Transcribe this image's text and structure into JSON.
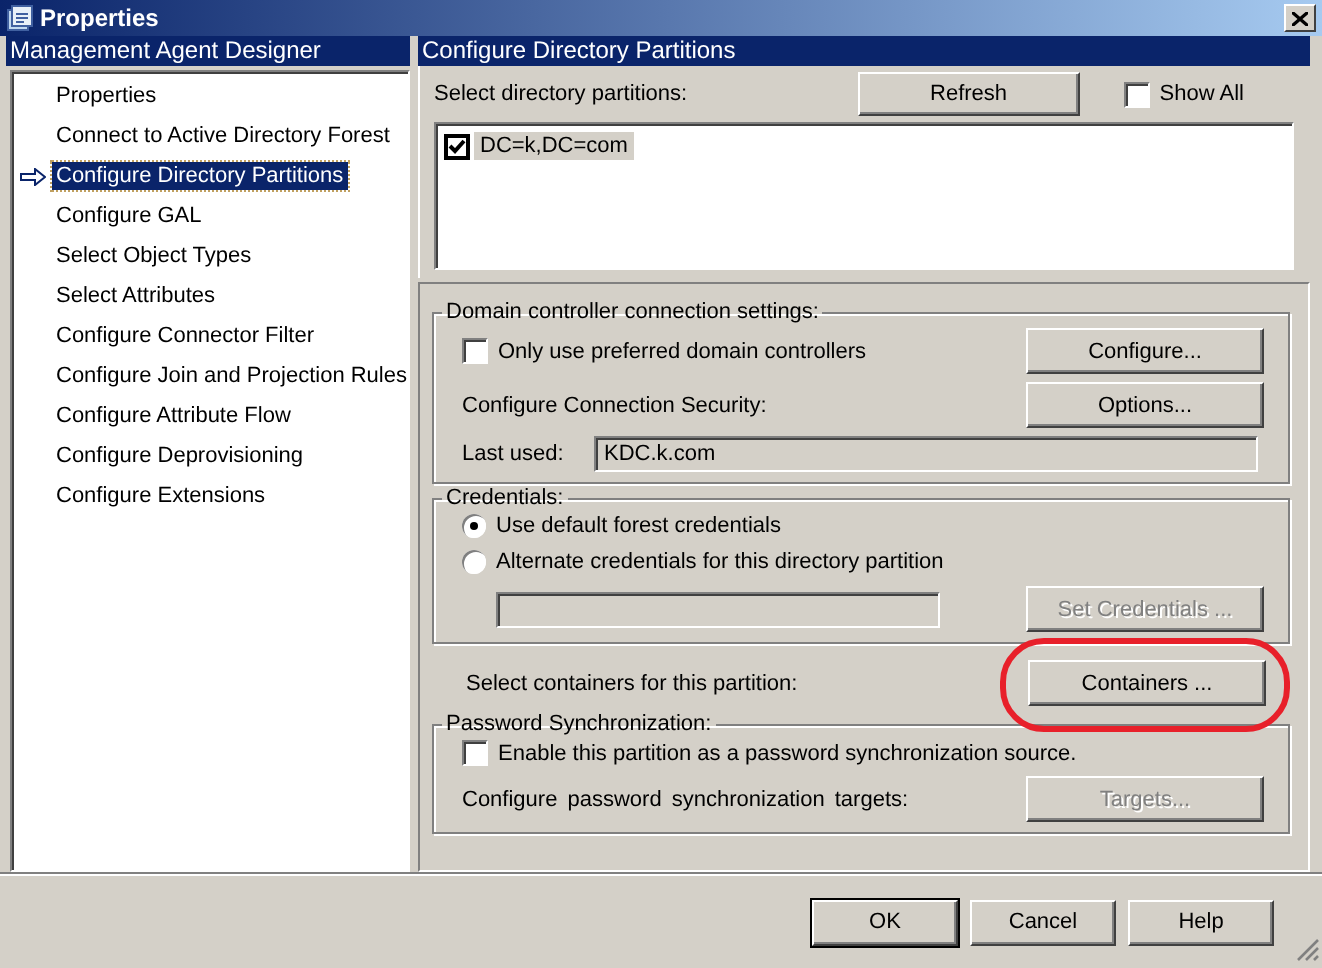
{
  "window": {
    "title": "Properties"
  },
  "sidebar": {
    "header": "Management Agent Designer",
    "items": [
      {
        "label": "Properties",
        "selected": false
      },
      {
        "label": "Connect to Active Directory Forest",
        "selected": false
      },
      {
        "label": "Configure Directory Partitions",
        "selected": true
      },
      {
        "label": "Configure GAL",
        "selected": false
      },
      {
        "label": "Select Object Types",
        "selected": false
      },
      {
        "label": "Select Attributes",
        "selected": false
      },
      {
        "label": "Configure Connector Filter",
        "selected": false
      },
      {
        "label": "Configure Join and Projection Rules",
        "selected": false
      },
      {
        "label": "Configure Attribute Flow",
        "selected": false
      },
      {
        "label": "Configure Deprovisioning",
        "selected": false
      },
      {
        "label": "Configure Extensions",
        "selected": false
      }
    ]
  },
  "pane": {
    "header": "Configure Directory Partitions",
    "partitions": {
      "label": "Select directory partitions:",
      "refresh_button": {
        "label": "Refresh",
        "disabled": false
      },
      "show_all": {
        "label": "Show All",
        "checked": false
      },
      "items": [
        {
          "label": "DC=k,DC=com",
          "checked": true
        }
      ]
    },
    "dc_settings": {
      "title": "Domain controller connection settings:",
      "preferred": {
        "label": "Only use preferred domain controllers",
        "checked": false
      },
      "configure_button": {
        "label": "Configure...",
        "disabled": false
      },
      "security_label": "Configure Connection Security:",
      "options_button": {
        "label": "Options...",
        "disabled": false
      },
      "last_used_label": "Last used:",
      "last_used_value": "KDC.k.com"
    },
    "credentials": {
      "title": "Credentials:",
      "options": [
        {
          "label": "Use default forest credentials",
          "selected": true
        },
        {
          "label": "Alternate credentials for this directory partition",
          "selected": false
        }
      ],
      "alternate_field": {
        "disabled": true
      },
      "set_button": {
        "label": "Set Credentials ...",
        "disabled": true
      }
    },
    "containers": {
      "label": "Select containers for this partition:",
      "button": {
        "label": "Containers ...",
        "disabled": false,
        "highlighted": true
      }
    },
    "password_sync": {
      "title": "Password Synchronization:",
      "enable": {
        "label": "Enable this partition as a password synchronization source.",
        "checked": false
      },
      "targets_label": "Configure password synchronization targets:",
      "targets_button": {
        "label": "Targets...",
        "disabled": true
      }
    }
  },
  "buttons": [
    {
      "label": "OK",
      "default": true
    },
    {
      "label": "Cancel",
      "default": false
    },
    {
      "label": "Help",
      "default": false
    }
  ]
}
